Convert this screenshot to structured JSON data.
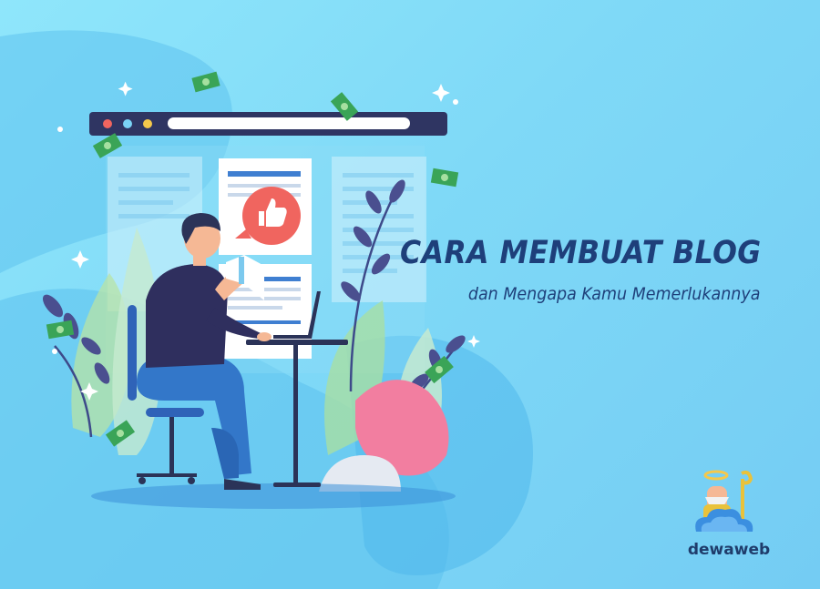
{
  "headline": {
    "title": "CARA MEMBUAT BLOG",
    "subtitle": "dan Mengapa Kamu Memerlukannya"
  },
  "brand": {
    "name": "dewaweb"
  },
  "icons": [
    "browser-window",
    "thumbs-up-icon",
    "megaphone-icon",
    "laptop-icon",
    "money-bill-icon",
    "sparkle-icon"
  ],
  "colors": {
    "background": "#7fd9f7",
    "headline": "#1e3f7a",
    "accent_red": "#f0655f",
    "browser_bar": "#2f3562",
    "money_green": "#3aa457"
  }
}
